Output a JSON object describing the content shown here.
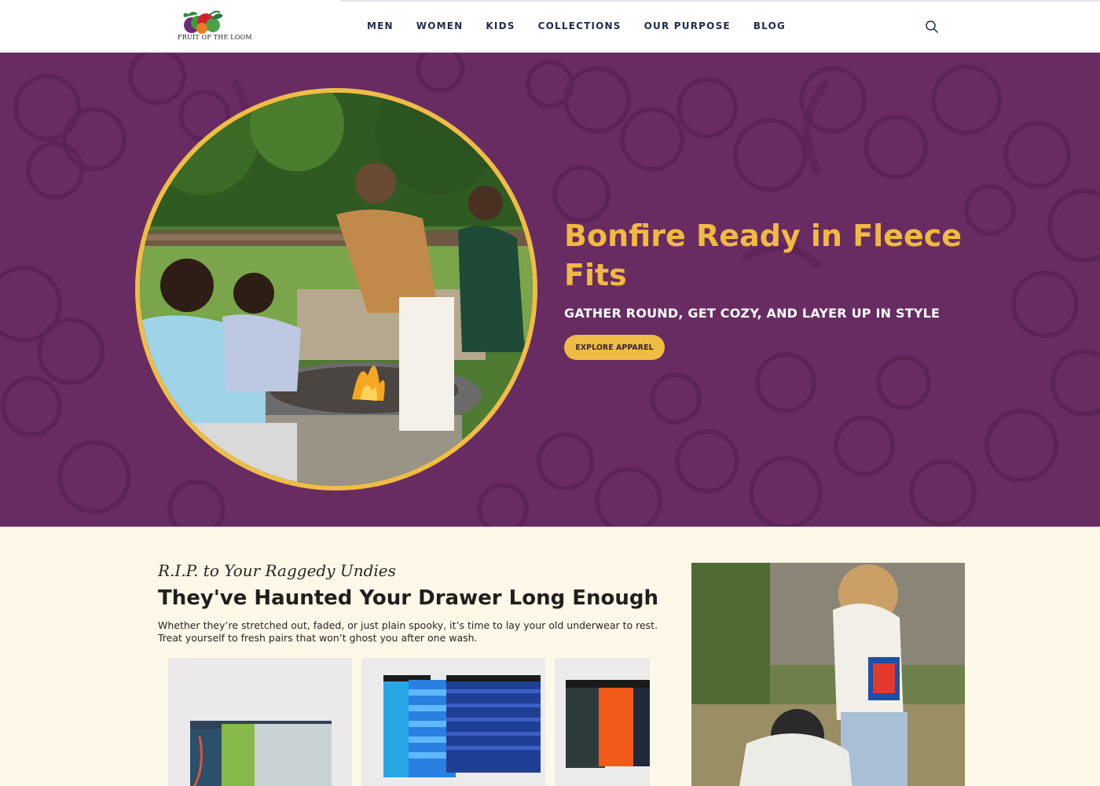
{
  "brand": {
    "logo_alt": "Fruit of the Loom logo",
    "logo_text": "FRUIT OF THE LOOM"
  },
  "nav": {
    "items": [
      {
        "label": "MEN"
      },
      {
        "label": "WOMEN"
      },
      {
        "label": "KIDS"
      },
      {
        "label": "COLLECTIONS"
      },
      {
        "label": "OUR PURPOSE"
      },
      {
        "label": "BLOG"
      }
    ],
    "search_icon": "search-icon"
  },
  "hero": {
    "title": "Bonfire Ready in Fleece Fits",
    "subtitle": "GATHER ROUND, GET COZY, AND LAYER UP IN STYLE",
    "cta_label": "EXPLORE APPAREL",
    "image": "family-around-fire-pit-photo",
    "colors": {
      "background": "#682c63",
      "accent": "#efbd45"
    }
  },
  "promo": {
    "script_title": "R.I.P. to Your Raggedy Undies",
    "title": "They've Haunted Your Drawer Long Enough",
    "body": "Whether they’re stretched out, faded, or just plain spooky, it’s time to lay your old underwear to rest. Treat yourself to fresh pairs that won’t ghost you after one wash.",
    "products": [
      {
        "image": "multicolor-boxer-briefs-pack"
      },
      {
        "image": "blue-striped-boxer-briefs-pack"
      },
      {
        "image": "black-orange-boxer-briefs-pack"
      }
    ],
    "side_image": "woman-holding-underwear-pack-photo",
    "colors": {
      "background": "#fdf8e7"
    }
  }
}
